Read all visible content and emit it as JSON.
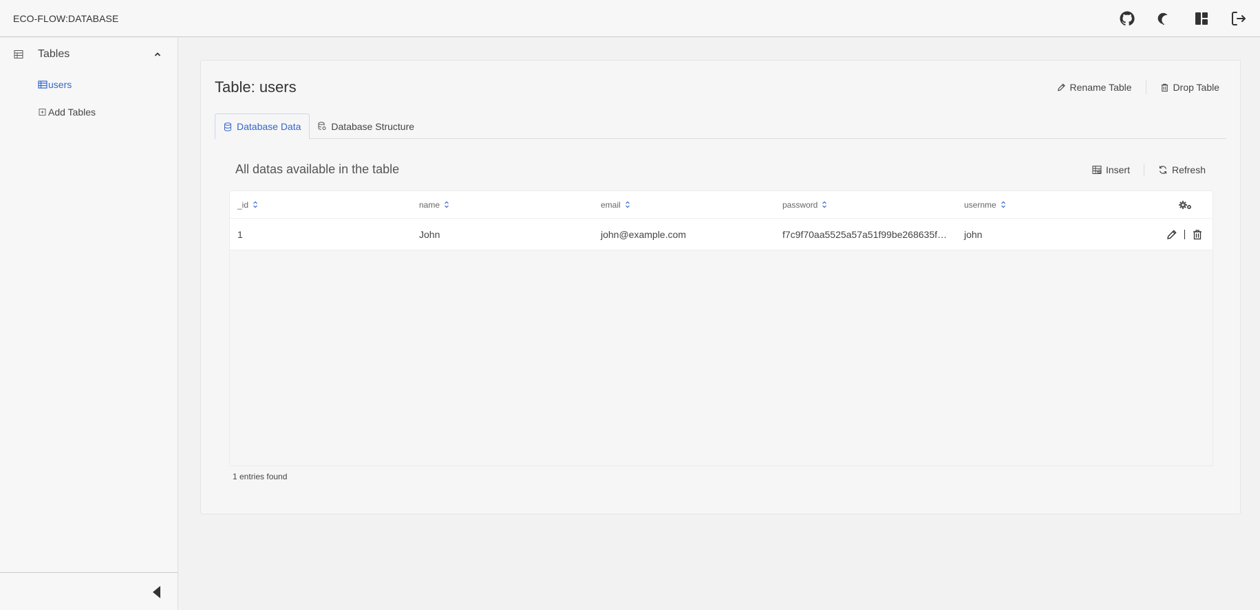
{
  "header": {
    "brand": "ECO-FLOW:DATABASE",
    "icons": [
      "github-icon",
      "moon-icon",
      "layout-icon",
      "logout-icon"
    ]
  },
  "sidebar": {
    "section_label": "Tables",
    "items": [
      {
        "label": "users",
        "active": true
      },
      {
        "label": "Add Tables",
        "active": false
      }
    ]
  },
  "page": {
    "title": "Table: users",
    "actions": {
      "rename": "Rename Table",
      "drop": "Drop Table"
    },
    "tabs": [
      {
        "label": "Database Data",
        "active": true
      },
      {
        "label": "Database Structure",
        "active": false
      }
    ],
    "section_title": "All datas available in the table",
    "section_actions": {
      "insert": "Insert",
      "refresh": "Refresh"
    },
    "table": {
      "columns": [
        "_id",
        "name",
        "email",
        "password",
        "usernme"
      ],
      "rows": [
        [
          "1",
          "John",
          "john@example.com",
          "f7c9f70aa5525a57a51f99be268635f3...",
          "john"
        ]
      ]
    },
    "entries_text": "1 entries found"
  },
  "colors": {
    "accent": "#3367c9",
    "background": "#f2f2f3",
    "card": "#f6f6f7"
  }
}
